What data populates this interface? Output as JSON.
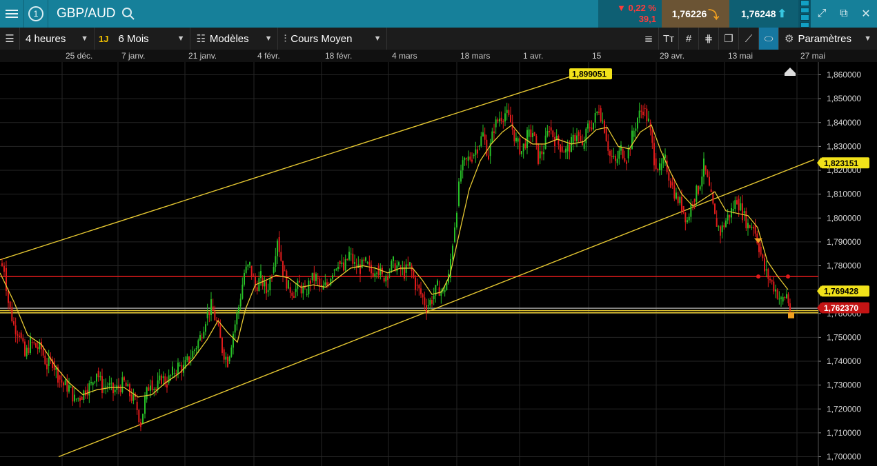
{
  "header": {
    "symbol": "GBP/AUD",
    "change_pct": "▼ 0,22 %",
    "change_pts": "39,1",
    "bid": "1,76226",
    "ask": "1,76248"
  },
  "toolbar": {
    "interval": "4 heures",
    "quick_range": "1J",
    "range": "6 Mois",
    "templates": "Modèles",
    "price_type": "Cours Moyen",
    "settings": "Paramètres"
  },
  "chart_data": {
    "type": "candlestick",
    "instrument": "GBP/AUD",
    "dates": [
      "25 déc.",
      "7 janv.",
      "21 janv.",
      "4 févr.",
      "18 févr.",
      "4 mars",
      "18 mars",
      "1 avr.",
      "15",
      "29 avr.",
      "13 mai",
      "27 mai"
    ],
    "y_ticks": [
      "1,860000",
      "1,850000",
      "1,840000",
      "1,830000",
      "1,820000",
      "1,810000",
      "1,800000",
      "1,790000",
      "1,780000",
      "1,770000",
      "1,760000",
      "1,750000",
      "1,740000",
      "1,730000",
      "1,720000",
      "1,710000",
      "1,700000"
    ],
    "ylim": [
      1.7,
      1.86
    ],
    "ma_line_color": "#e6c832",
    "up_color": "#27c027",
    "down_color": "#e01b1b",
    "path_points": [
      [
        0,
        1.781
      ],
      [
        6,
        1.779
      ],
      [
        12,
        1.765
      ],
      [
        20,
        1.755
      ],
      [
        28,
        1.752
      ],
      [
        36,
        1.742
      ],
      [
        44,
        1.748
      ],
      [
        52,
        1.746
      ],
      [
        60,
        1.745
      ],
      [
        68,
        1.738
      ],
      [
        76,
        1.74
      ],
      [
        84,
        1.734
      ],
      [
        92,
        1.73
      ],
      [
        100,
        1.729
      ],
      [
        108,
        1.724
      ],
      [
        116,
        1.725
      ],
      [
        124,
        1.728
      ],
      [
        132,
        1.73
      ],
      [
        140,
        1.736
      ],
      [
        148,
        1.729
      ],
      [
        156,
        1.73
      ],
      [
        164,
        1.727
      ],
      [
        172,
        1.729
      ],
      [
        180,
        1.731
      ],
      [
        188,
        1.726
      ],
      [
        196,
        1.723
      ],
      [
        204,
        1.714
      ],
      [
        210,
        1.724
      ],
      [
        218,
        1.732
      ],
      [
        226,
        1.728
      ],
      [
        234,
        1.733
      ],
      [
        242,
        1.731
      ],
      [
        250,
        1.735
      ],
      [
        258,
        1.738
      ],
      [
        266,
        1.737
      ],
      [
        274,
        1.741
      ],
      [
        282,
        1.745
      ],
      [
        290,
        1.75
      ],
      [
        298,
        1.758
      ],
      [
        306,
        1.763
      ],
      [
        314,
        1.756
      ],
      [
        322,
        1.745
      ],
      [
        330,
        1.74
      ],
      [
        338,
        1.752
      ],
      [
        346,
        1.763
      ],
      [
        354,
        1.777
      ],
      [
        362,
        1.78
      ],
      [
        370,
        1.771
      ],
      [
        378,
        1.775
      ],
      [
        386,
        1.769
      ],
      [
        394,
        1.777
      ],
      [
        402,
        1.792
      ],
      [
        410,
        1.778
      ],
      [
        418,
        1.771
      ],
      [
        426,
        1.769
      ],
      [
        434,
        1.772
      ],
      [
        442,
        1.768
      ],
      [
        450,
        1.774
      ],
      [
        458,
        1.775
      ],
      [
        466,
        1.77
      ],
      [
        474,
        1.772
      ],
      [
        482,
        1.778
      ],
      [
        490,
        1.782
      ],
      [
        498,
        1.778
      ],
      [
        506,
        1.785
      ],
      [
        514,
        1.78
      ],
      [
        522,
        1.779
      ],
      [
        530,
        1.781
      ],
      [
        538,
        1.777
      ],
      [
        546,
        1.78
      ],
      [
        554,
        1.775
      ],
      [
        562,
        1.777
      ],
      [
        570,
        1.781
      ],
      [
        578,
        1.779
      ],
      [
        586,
        1.777
      ],
      [
        594,
        1.78
      ],
      [
        602,
        1.772
      ],
      [
        610,
        1.768
      ],
      [
        618,
        1.763
      ],
      [
        626,
        1.766
      ],
      [
        634,
        1.771
      ],
      [
        642,
        1.769
      ],
      [
        650,
        1.775
      ],
      [
        656,
        1.79
      ],
      [
        662,
        1.805
      ],
      [
        668,
        1.82
      ],
      [
        676,
        1.824
      ],
      [
        684,
        1.826
      ],
      [
        692,
        1.83
      ],
      [
        700,
        1.835
      ],
      [
        708,
        1.826
      ],
      [
        716,
        1.838
      ],
      [
        724,
        1.842
      ],
      [
        732,
        1.844
      ],
      [
        740,
        1.84
      ],
      [
        748,
        1.832
      ],
      [
        756,
        1.828
      ],
      [
        764,
        1.834
      ],
      [
        772,
        1.836
      ],
      [
        780,
        1.825
      ],
      [
        788,
        1.829
      ],
      [
        796,
        1.838
      ],
      [
        804,
        1.833
      ],
      [
        812,
        1.83
      ],
      [
        820,
        1.828
      ],
      [
        828,
        1.831
      ],
      [
        836,
        1.836
      ],
      [
        844,
        1.829
      ],
      [
        852,
        1.838
      ],
      [
        860,
        1.84
      ],
      [
        868,
        1.846
      ],
      [
        876,
        1.838
      ],
      [
        884,
        1.826
      ],
      [
        892,
        1.823
      ],
      [
        900,
        1.829
      ],
      [
        908,
        1.825
      ],
      [
        916,
        1.834
      ],
      [
        924,
        1.842
      ],
      [
        932,
        1.846
      ],
      [
        940,
        1.84
      ],
      [
        948,
        1.825
      ],
      [
        956,
        1.82
      ],
      [
        964,
        1.824
      ],
      [
        972,
        1.815
      ],
      [
        980,
        1.809
      ],
      [
        988,
        1.805
      ],
      [
        996,
        1.799
      ],
      [
        1004,
        1.808
      ],
      [
        1012,
        1.812
      ],
      [
        1020,
        1.822
      ],
      [
        1028,
        1.812
      ],
      [
        1036,
        1.8
      ],
      [
        1044,
        1.794
      ],
      [
        1052,
        1.799
      ],
      [
        1060,
        1.803
      ],
      [
        1068,
        1.808
      ],
      [
        1076,
        1.802
      ],
      [
        1084,
        1.797
      ],
      [
        1092,
        1.797
      ],
      [
        1100,
        1.788
      ],
      [
        1108,
        1.778
      ],
      [
        1116,
        1.774
      ],
      [
        1124,
        1.77
      ],
      [
        1132,
        1.765
      ],
      [
        1140,
        1.768
      ],
      [
        1145,
        1.762
      ]
    ],
    "ma_points": [
      [
        0,
        1.777
      ],
      [
        20,
        1.765
      ],
      [
        40,
        1.751
      ],
      [
        60,
        1.747
      ],
      [
        80,
        1.738
      ],
      [
        100,
        1.731
      ],
      [
        120,
        1.726
      ],
      [
        140,
        1.728
      ],
      [
        160,
        1.729
      ],
      [
        180,
        1.729
      ],
      [
        200,
        1.725
      ],
      [
        220,
        1.726
      ],
      [
        240,
        1.731
      ],
      [
        260,
        1.735
      ],
      [
        280,
        1.741
      ],
      [
        300,
        1.749
      ],
      [
        316,
        1.757
      ],
      [
        330,
        1.752
      ],
      [
        344,
        1.748
      ],
      [
        356,
        1.762
      ],
      [
        370,
        1.772
      ],
      [
        386,
        1.774
      ],
      [
        400,
        1.776
      ],
      [
        418,
        1.775
      ],
      [
        436,
        1.771
      ],
      [
        454,
        1.772
      ],
      [
        472,
        1.771
      ],
      [
        490,
        1.775
      ],
      [
        508,
        1.779
      ],
      [
        526,
        1.78
      ],
      [
        544,
        1.779
      ],
      [
        562,
        1.777
      ],
      [
        580,
        1.779
      ],
      [
        598,
        1.779
      ],
      [
        612,
        1.774
      ],
      [
        626,
        1.768
      ],
      [
        640,
        1.769
      ],
      [
        652,
        1.776
      ],
      [
        666,
        1.794
      ],
      [
        680,
        1.812
      ],
      [
        696,
        1.824
      ],
      [
        712,
        1.831
      ],
      [
        728,
        1.836
      ],
      [
        742,
        1.839
      ],
      [
        756,
        1.834
      ],
      [
        772,
        1.831
      ],
      [
        790,
        1.831
      ],
      [
        808,
        1.833
      ],
      [
        828,
        1.831
      ],
      [
        846,
        1.832
      ],
      [
        864,
        1.837
      ],
      [
        880,
        1.838
      ],
      [
        896,
        1.83
      ],
      [
        912,
        1.829
      ],
      [
        928,
        1.836
      ],
      [
        944,
        1.839
      ],
      [
        958,
        1.828
      ],
      [
        972,
        1.819
      ],
      [
        988,
        1.81
      ],
      [
        1004,
        1.805
      ],
      [
        1020,
        1.808
      ],
      [
        1036,
        1.811
      ],
      [
        1052,
        1.803
      ],
      [
        1068,
        1.802
      ],
      [
        1084,
        1.801
      ],
      [
        1098,
        1.796
      ],
      [
        1112,
        1.782
      ],
      [
        1126,
        1.776
      ],
      [
        1142,
        1.77
      ]
    ],
    "horizontal_lines": [
      {
        "price": 1.7755,
        "color": "#e01b1b"
      },
      {
        "price": 1.7612,
        "color": "#e6c832"
      },
      {
        "price": 1.7603,
        "color": "#e6c832"
      },
      {
        "price": 1.7622,
        "color": "#999999"
      }
    ],
    "trendlines": [
      {
        "from": [
          0,
          1.7825
        ],
        "to": [
          840,
          1.8605
        ],
        "color": "#e6c832"
      },
      {
        "from": [
          85,
          1.7
        ],
        "to": [
          1180,
          1.8245
        ],
        "color": "#e6c832"
      }
    ],
    "labels": [
      {
        "text": "1,899051",
        "at": [
          856,
          1.8604
        ],
        "bg": "#f2e21a",
        "fg": "#000"
      },
      {
        "text": "1,823151",
        "at": [
          1221,
          1.8231
        ],
        "bg": "#f2e21a",
        "fg": "#000"
      },
      {
        "text": "1,769428",
        "at": [
          1223,
          1.7694
        ],
        "bg": "#f2e21a",
        "fg": "#000"
      },
      {
        "text": "1,762370",
        "at": [
          1223,
          1.7624
        ],
        "bg": "#c41414",
        "fg": "#fff"
      }
    ]
  }
}
